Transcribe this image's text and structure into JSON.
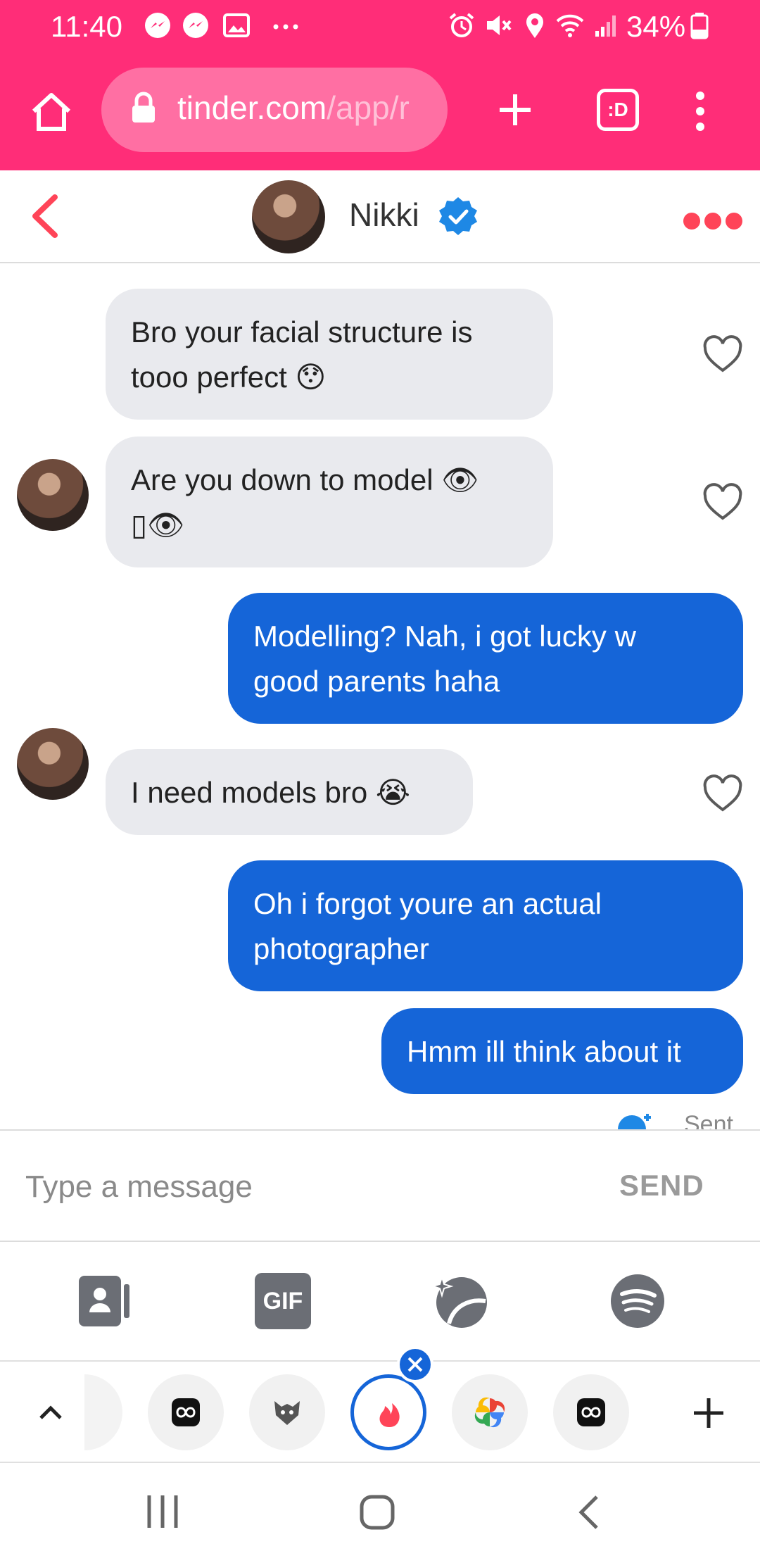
{
  "status_bar": {
    "time": "11:40",
    "battery": "34%",
    "icons": [
      "messenger-icon",
      "messenger-icon",
      "gallery-icon",
      "more-dots-icon",
      "alarm-icon",
      "mute-icon",
      "location-icon",
      "wifi-icon",
      "signal-icon",
      "battery-icon"
    ]
  },
  "browser": {
    "url_host": "tinder.com",
    "url_path": "/app/r",
    "tab_count": ":D",
    "accent": "#ff2d78"
  },
  "chat_header": {
    "name": "Nikki",
    "verified": true
  },
  "messages": [
    {
      "dir": "in",
      "lines": [
        "Bro your facial structure is",
        "tooo perfect 😯"
      ],
      "liked": false
    },
    {
      "dir": "in",
      "lines": [
        "Are you down to model 👁",
        "▯👁"
      ],
      "liked": false
    },
    {
      "dir": "out",
      "lines": [
        "Modelling? Nah, i got lucky w",
        "good parents haha"
      ]
    },
    {
      "dir": "in",
      "lines": [
        "I need models bro 😭"
      ],
      "liked": false
    },
    {
      "dir": "out",
      "lines": [
        "Oh i forgot youre an actual",
        "photographer"
      ]
    },
    {
      "dir": "out",
      "lines": [
        "Hmm ill think about it"
      ]
    }
  ],
  "receipt": "Sent",
  "composer": {
    "placeholder": "Type a message",
    "send_label": "SEND"
  },
  "attachments": [
    "contact-card-icon",
    "gif-icon",
    "sticker-icon",
    "spotify-icon"
  ],
  "gif_label": "GIF",
  "tray": {
    "items": [
      "app-icon",
      "app-icon",
      "wolf-app-icon",
      "tinder-icon",
      "photos-icon",
      "app-icon"
    ],
    "add_label": "+"
  },
  "colors": {
    "in_bubble": "#e9eaee",
    "out_bubble": "#1565d8",
    "back_arrow": "#ff4458",
    "verified": "#1e88e5"
  }
}
